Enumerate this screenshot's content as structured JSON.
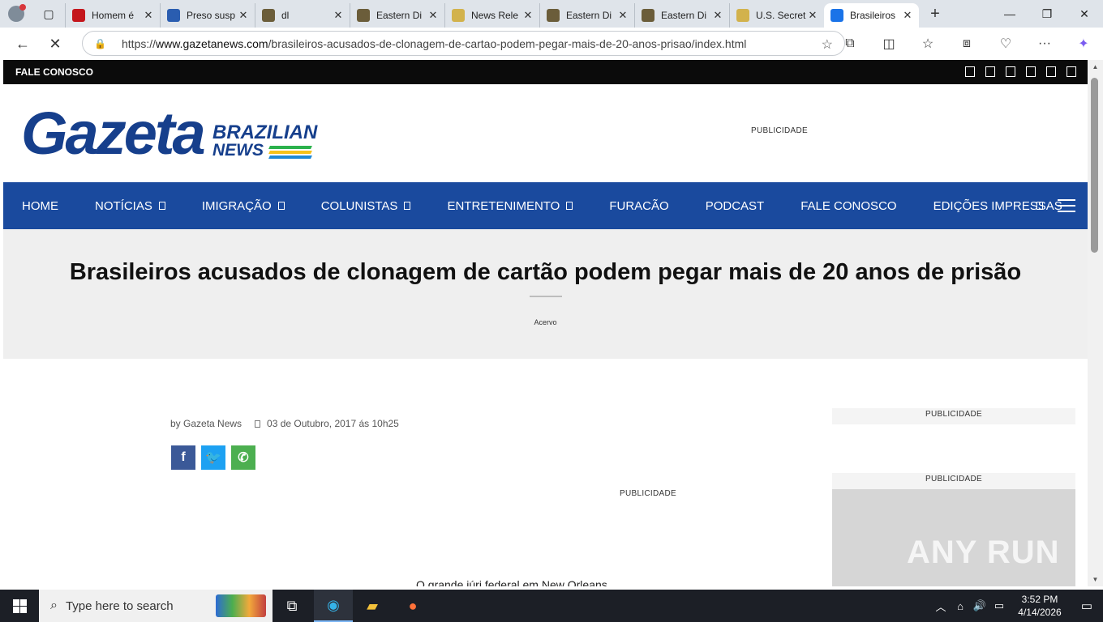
{
  "browser": {
    "tabs": [
      {
        "title": "Homem é",
        "favicon": "g1",
        "color": "#c4161c"
      },
      {
        "title": "Preso susp",
        "favicon": "news-favicon",
        "color": "#2a5db0"
      },
      {
        "title": "dl",
        "favicon": "doj-seal",
        "color": "#6b5d3a"
      },
      {
        "title": "Eastern Di",
        "favicon": "doj-seal",
        "color": "#6b5d3a"
      },
      {
        "title": "News Rele",
        "favicon": "star-badge",
        "color": "#d2b24c"
      },
      {
        "title": "Eastern Di",
        "favicon": "doj-seal",
        "color": "#6b5d3a"
      },
      {
        "title": "Eastern Di",
        "favicon": "doj-seal",
        "color": "#6b5d3a"
      },
      {
        "title": "U.S. Secret",
        "favicon": "star-badge",
        "color": "#d2b24c"
      },
      {
        "title": "Brasileiros",
        "favicon": "loading-spinner",
        "color": "#1a73e8",
        "active": true
      }
    ],
    "url_prefix": "https://",
    "url_host": "www.gazetanews.com",
    "url_path": "/brasileiros-acusados-de-clonagem-de-cartao-podem-pegar-mais-de-20-anos-prisao/index.html"
  },
  "site": {
    "topbar_link": "FALE CONOSCO",
    "logo_main": "Gazeta",
    "logo_sub1": "BRAZILIAN",
    "logo_sub2": "NEWS",
    "header_ad_label": "PUBLICIDADE",
    "nav": [
      {
        "label": "HOME",
        "has_dropdown": false
      },
      {
        "label": "NOTÍCIAS",
        "has_dropdown": true
      },
      {
        "label": "IMIGRAÇÃO",
        "has_dropdown": true
      },
      {
        "label": "COLUNISTAS",
        "has_dropdown": true
      },
      {
        "label": "ENTRETENIMENTO",
        "has_dropdown": true
      },
      {
        "label": "FURACÃO",
        "has_dropdown": false
      },
      {
        "label": "PODCAST",
        "has_dropdown": false
      },
      {
        "label": "FALE CONOSCO",
        "has_dropdown": false
      },
      {
        "label": "EDIÇÕES IMPRESSAS",
        "has_dropdown": false
      }
    ]
  },
  "article": {
    "title": "Brasileiros acusados de clonagem de cartão podem pegar mais de 20 anos de prisão",
    "category": "Acervo",
    "byline": "by Gazeta News",
    "date": "03 de Outubro, 2017 ás 10h25",
    "inline_ad_label": "PUBLICIDADE",
    "first_line": "O grande júri federal em New Orleans"
  },
  "sidebar": {
    "ad1_label": "PUBLICIDADE",
    "ad2_label": "PUBLICIDADE",
    "watermark": "ANY RUN"
  },
  "taskbar": {
    "search_placeholder": "Type here to search",
    "time": "3:52 PM",
    "date": "4/14/2026"
  },
  "colors": {
    "nav_blue": "#1a4a9e",
    "logo_blue": "#163f8c",
    "hero_bg": "#efefef"
  }
}
